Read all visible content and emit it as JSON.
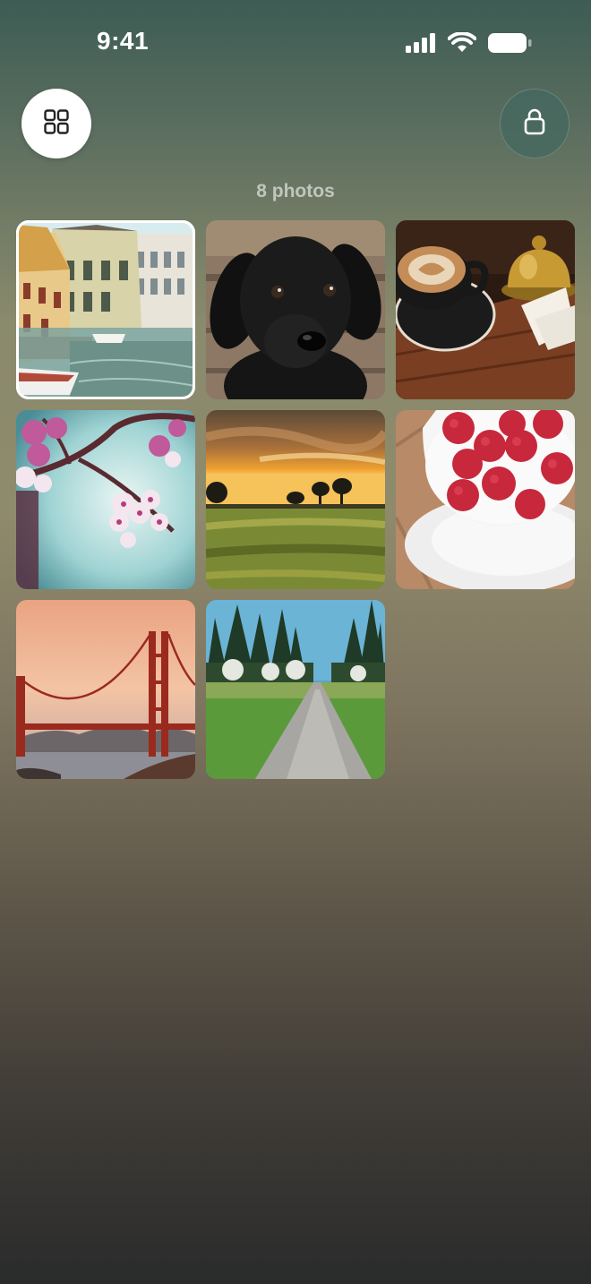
{
  "status_bar": {
    "time": "9:41",
    "icons": [
      "cellular-signal-icon",
      "wifi-icon",
      "battery-icon"
    ]
  },
  "toolbar": {
    "left_button_icon": "grid-icon",
    "right_button_icon": "lock-icon"
  },
  "gallery": {
    "count_label": "8 photos",
    "selected_index": 0,
    "photos": [
      {
        "subject": "canal-houses"
      },
      {
        "subject": "black-puppy"
      },
      {
        "subject": "latte-and-bell"
      },
      {
        "subject": "cherry-blossoms"
      },
      {
        "subject": "sunset-field"
      },
      {
        "subject": "raspberries-cup"
      },
      {
        "subject": "golden-gate-bridge"
      },
      {
        "subject": "forest-path"
      }
    ]
  },
  "colors": {
    "accent_lock_button": "#46695f",
    "grid_button_bg": "#ffffff"
  }
}
